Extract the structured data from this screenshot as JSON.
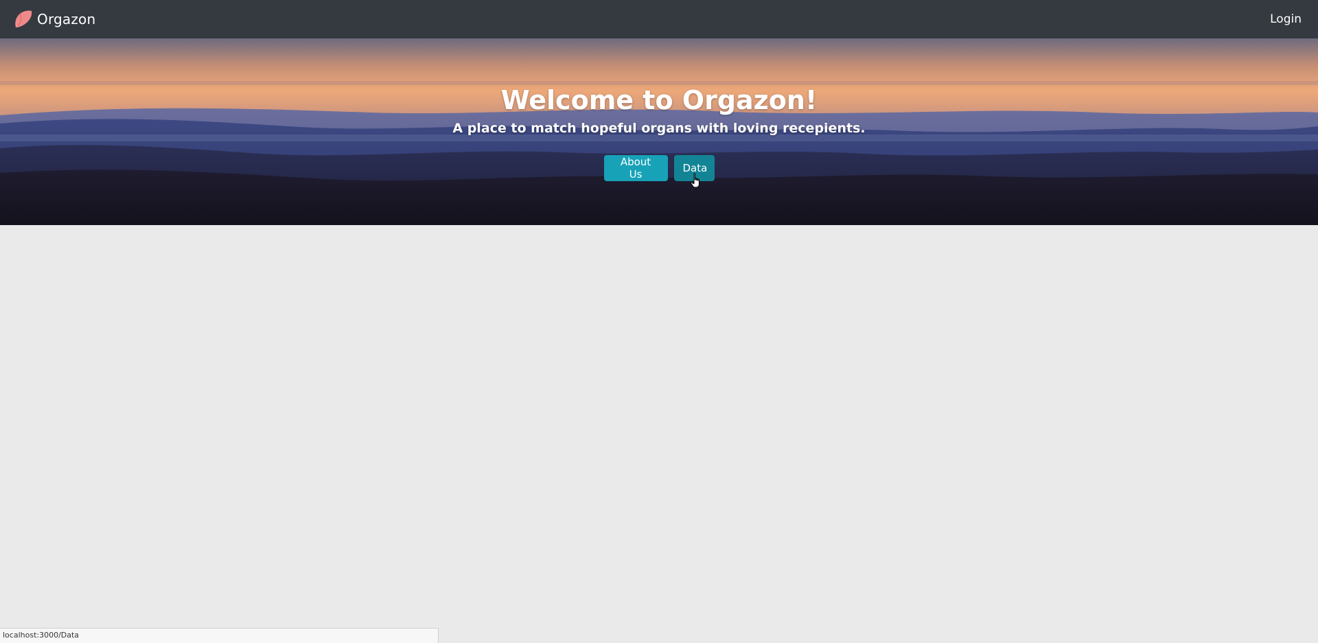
{
  "navbar": {
    "brand_name": "Orgazon",
    "brand_icon": "liver-organ-icon",
    "login_label": "Login",
    "background_color": "#343a40"
  },
  "hero": {
    "title": "Welcome to Orgazon!",
    "subtitle": "A place to match hopeful organs with loving recepients.",
    "buttons": [
      {
        "label": "About Us"
      },
      {
        "label": "Data",
        "hovered": true
      }
    ],
    "button_color": "#17a2b8",
    "button_hover_color": "#138496"
  },
  "page": {
    "background_color": "#eaeaea"
  },
  "status_bar": {
    "url": "localhost:3000/Data"
  }
}
